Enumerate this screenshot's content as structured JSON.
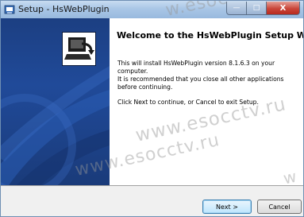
{
  "window": {
    "title": "Setup - HsWebPlugin",
    "min_glyph": "—",
    "max_glyph": "□",
    "close_glyph": "X"
  },
  "wizard": {
    "heading": "Welcome to the HsWebPlugin Setup Wizard",
    "para1": "This will install HsWebPlugin version 8.1.6.3 on your computer.",
    "para2": "It is recommended that you close all other applications before continuing.",
    "para3": "Click Next to continue, or Cancel to exit Setup."
  },
  "buttons": {
    "next": "Next >",
    "cancel": "Cancel"
  },
  "watermark": {
    "text1": "www.esocctv.ru",
    "text2": "www.esocctv.ru",
    "text3": "w.esoc",
    "text4": "u",
    "text5": "w"
  },
  "colors": {
    "panel_blue": "#1f4896",
    "titlebar": "#a9c6e6",
    "close_red": "#c9463a"
  }
}
